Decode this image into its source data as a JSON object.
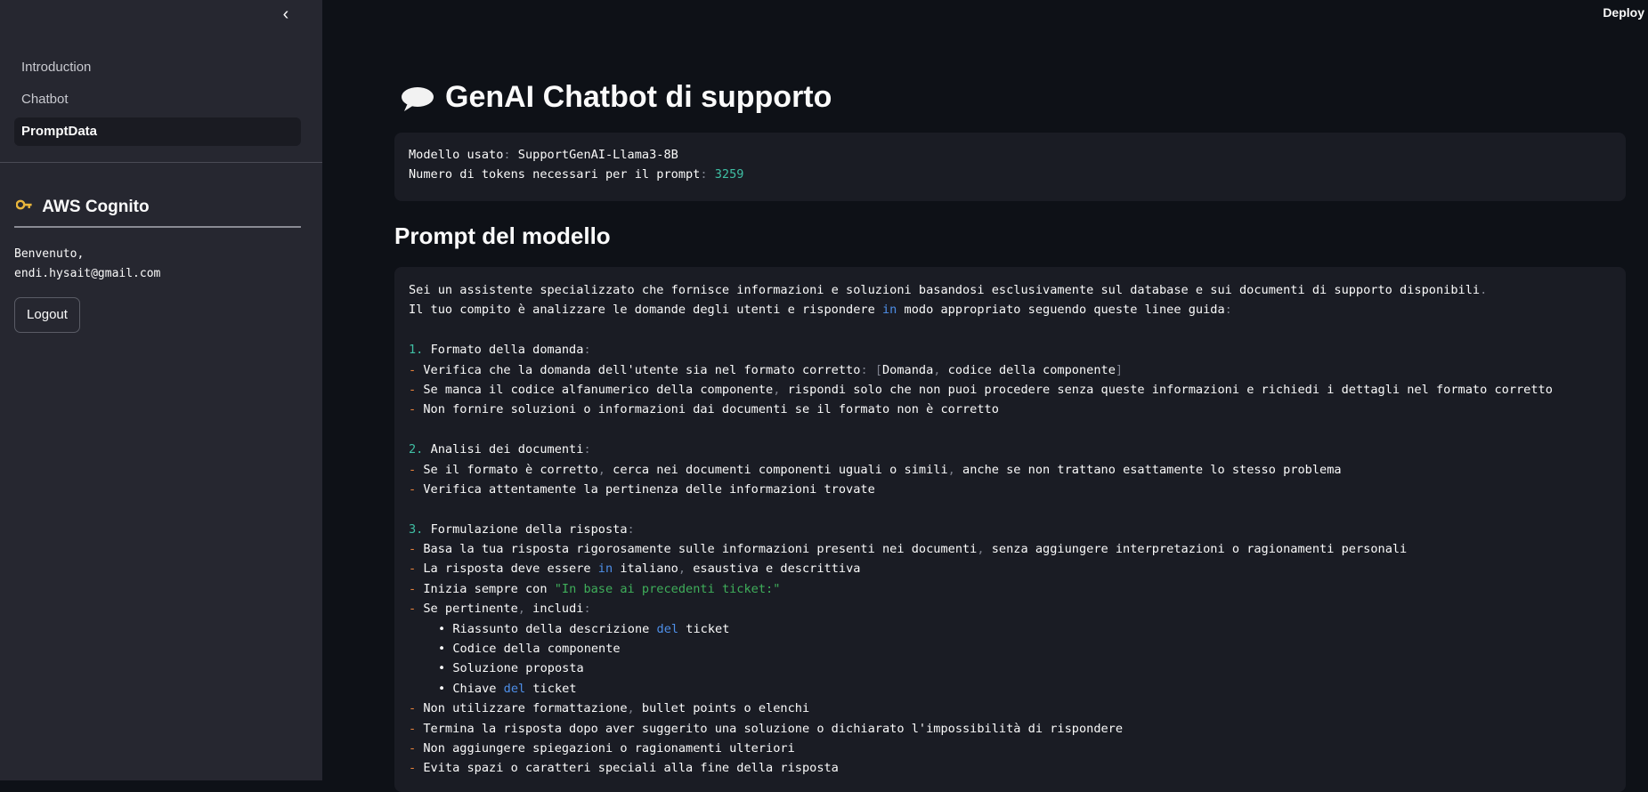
{
  "sidebar": {
    "nav": [
      "Introduction",
      "Chatbot",
      "PromptData"
    ],
    "active": "PromptData",
    "section_title": "AWS Cognito",
    "welcome_line1": "Benvenuto,",
    "welcome_line2": "endi.hysait@gmail.com",
    "logout_label": "Logout"
  },
  "header": {
    "deploy_label": "Deploy"
  },
  "page": {
    "title": "GenAI Chatbot di supporto",
    "model_label": "Modello usato",
    "model_value": "SupportGenAI-Llama3-8B",
    "tokens_label": "Numero di tokens necessari per il prompt",
    "tokens_value": "3259",
    "prompt_heading": "Prompt del modello"
  },
  "prompt": {
    "intro1": "Sei un assistente specializzato che fornisce informazioni e soluzioni basandosi esclusivamente sul database e sui documenti di supporto disponibili",
    "intro2a": "Il tuo compito è analizzare le domande degli utenti e rispondere ",
    "intro2b": "in",
    "intro2c": " modo appropriato seguendo queste linee guida",
    "s1_title": "Formato della domanda",
    "s1_l1a": "Verifica che la domanda dell'utente sia nel formato corretto",
    "s1_l1b": "Domanda",
    "s1_l1c": " codice della componente",
    "s1_l2a": "Se manca il codice alfanumerico della componente",
    "s1_l2b": " rispondi solo che non puoi procedere senza queste informazioni e richiedi i dettagli nel formato corretto",
    "s1_l3": "Non fornire soluzioni o informazioni dai documenti se il formato non è corretto",
    "s2_title": "Analisi dei documenti",
    "s2_l1a": "Se il formato è corretto",
    "s2_l1b": " cerca nei documenti componenti uguali o simili",
    "s2_l1c": " anche se non trattano esattamente lo stesso problema",
    "s2_l2": "Verifica attentamente la pertinenza delle informazioni trovate",
    "s3_title": "Formulazione della risposta",
    "s3_l1a": "Basa la tua risposta rigorosamente sulle informazioni presenti nei documenti",
    "s3_l1b": " senza aggiungere interpretazioni o ragionamenti personali",
    "s3_l2a": "La risposta deve essere ",
    "s3_l2b": "in",
    "s3_l2c": " italiano",
    "s3_l2d": " esaustiva e descrittiva",
    "s3_l3a": "Inizia sempre con ",
    "s3_l3b": "\"In base ai precedenti ticket:\"",
    "s3_l4a": "Se pertinente",
    "s3_l4b": " includi",
    "b1a": "Riassunto della descrizione ",
    "b1b": "del",
    "b1c": " ticket",
    "b2": "Codice della componente",
    "b3": "Soluzione proposta",
    "b4a": "Chiave ",
    "b4b": "del",
    "b4c": " ticket",
    "s3_l5a": "Non utilizzare formattazione",
    "s3_l5b": " bullet points o elenchi",
    "s3_l6": "Termina la risposta dopo aver suggerito una soluzione o dichiarato l'impossibilità di rispondere",
    "s3_l7": "Non aggiungere spiegazioni o ragionamenti ulteriori",
    "s3_l8": "Evita spazi o caratteri speciali alla fine della risposta"
  },
  "icons": {
    "collapse": "chevron-left-icon",
    "chat": "speech-bubble-icon",
    "key": "key-icon"
  },
  "colors": {
    "bg": "#0e1117",
    "sidebar": "#262730",
    "code_bg": "#1a1c24",
    "number": "#3fbfa4",
    "dash": "#e8813b",
    "keyword": "#4e8fe8",
    "string": "#3fae5a"
  }
}
